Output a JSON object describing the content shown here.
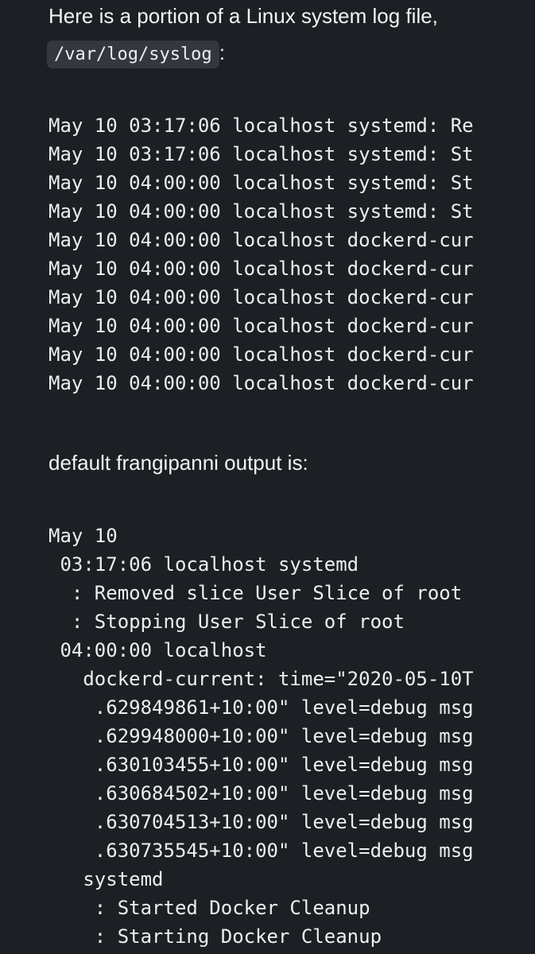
{
  "intro": {
    "line1": "Here is a portion of a Linux system log file,",
    "path": "/var/log/syslog",
    "after_path": ":"
  },
  "syslog_lines": [
    "May 10 03:17:06 localhost systemd: Re",
    "May 10 03:17:06 localhost systemd: St",
    "May 10 04:00:00 localhost systemd: St",
    "May 10 04:00:00 localhost systemd: St",
    "May 10 04:00:00 localhost dockerd-cur",
    "May 10 04:00:00 localhost dockerd-cur",
    "May 10 04:00:00 localhost dockerd-cur",
    "May 10 04:00:00 localhost dockerd-cur",
    "May 10 04:00:00 localhost dockerd-cur",
    "May 10 04:00:00 localhost dockerd-cur"
  ],
  "section2_heading": "default frangipanni output is:",
  "output_lines": [
    "May 10",
    " 03:17:06 localhost systemd",
    "  : Removed slice User Slice of root",
    "  : Stopping User Slice of root",
    " 04:00:00 localhost",
    "   dockerd-current: time=\"2020-05-10T",
    "    .629849861+10:00\" level=debug msg",
    "    .629948000+10:00\" level=debug msg",
    "    .630103455+10:00\" level=debug msg",
    "    .630684502+10:00\" level=debug msg",
    "    .630704513+10:00\" level=debug msg",
    "    .630735545+10:00\" level=debug msg",
    "   systemd",
    "    : Started Docker Cleanup",
    "    : Starting Docker Cleanup"
  ]
}
